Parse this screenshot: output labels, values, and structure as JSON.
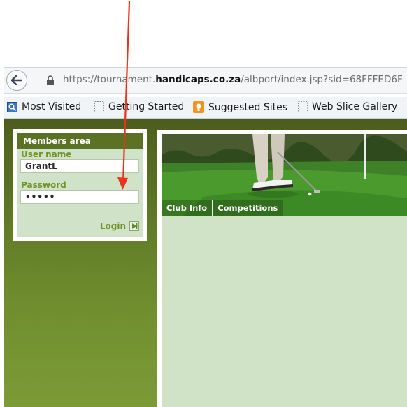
{
  "browser": {
    "url_prefix": "https://tournament.",
    "url_domain": "handicaps.co.za",
    "url_path": "/albport/index.jsp?sid=68FFFED6F",
    "bookmarks": [
      {
        "label": "Most Visited",
        "icon": "most-visited-icon"
      },
      {
        "label": "Getting Started",
        "icon": "page-icon"
      },
      {
        "label": "Suggested Sites",
        "icon": "suggested-sites-icon"
      },
      {
        "label": "Web Slice Gallery",
        "icon": "page-icon"
      }
    ]
  },
  "login": {
    "title": "Members area",
    "username_label": "User name",
    "username_value": "GrantL",
    "password_label": "Password",
    "password_value": "•••••",
    "login_label": "Login"
  },
  "nav": {
    "items": [
      "Club Info",
      "Competitions"
    ]
  },
  "colors": {
    "arrow": "#e8341c",
    "header_green": "#5b7124",
    "panel_green": "#d0e2c7",
    "label_green": "#6f9324"
  }
}
